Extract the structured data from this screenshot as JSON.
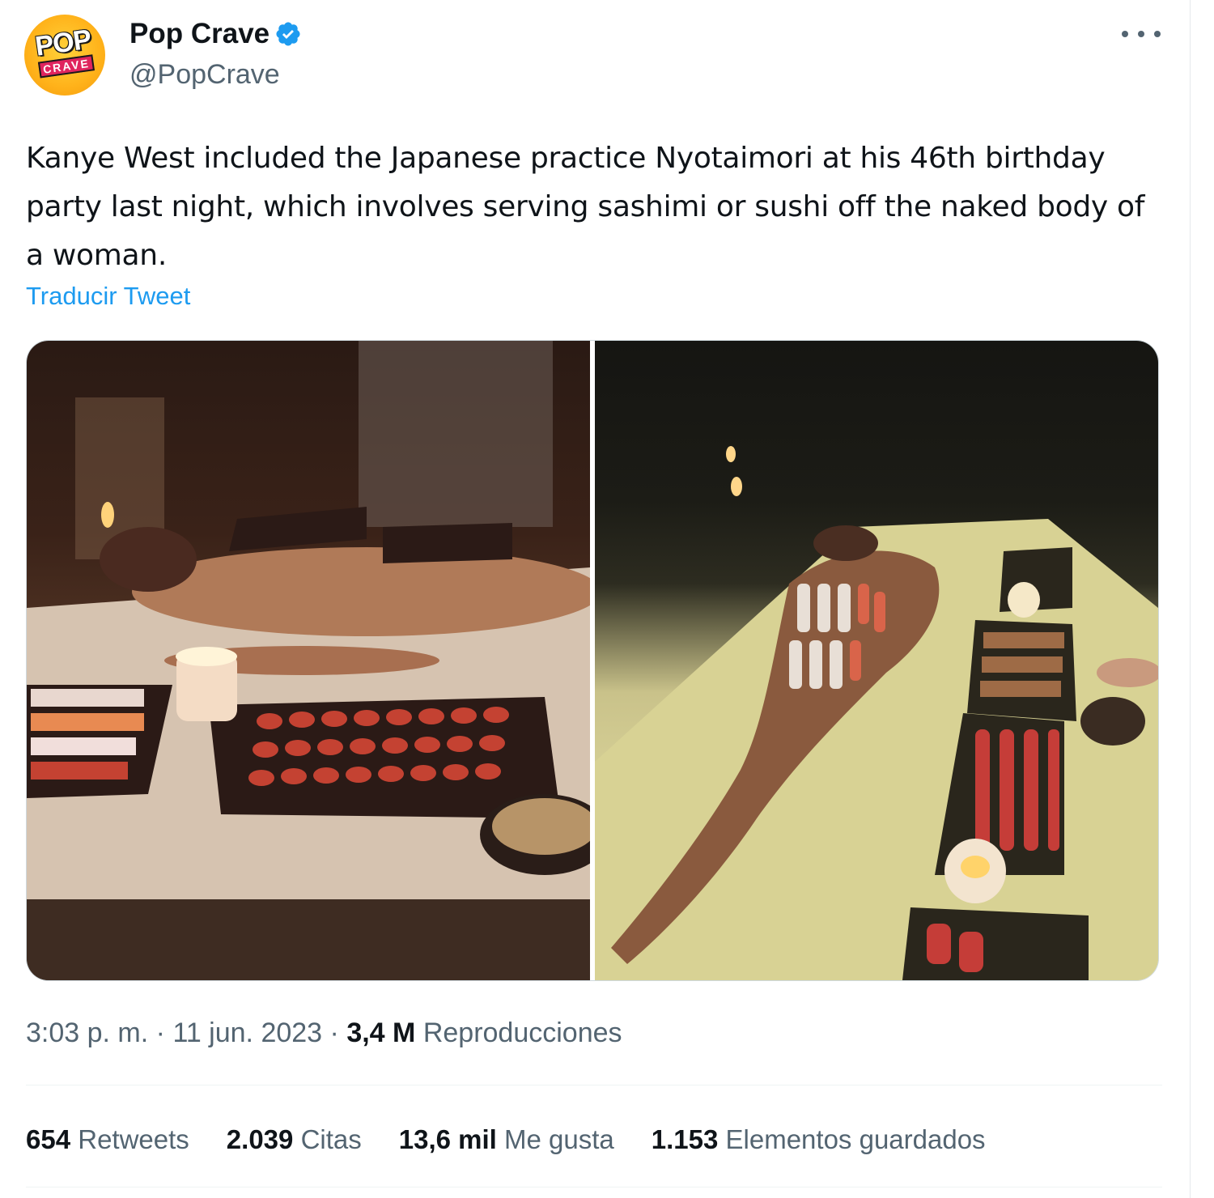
{
  "author": {
    "display_name": "Pop Crave",
    "handle": "@PopCrave",
    "avatar_text_top": "POP",
    "avatar_text_bottom": "CRAVE",
    "verified": true,
    "verified_color": "#1d9bf0"
  },
  "tweet": {
    "text": "Kanye West included the Japanese practice Nyotaimori at his 46th birthday party last night, which involves serving sashimi or sushi off the naked body of a woman.",
    "translate_label": "Traducir Tweet"
  },
  "media": {
    "count": 2,
    "photos": [
      "photo-1",
      "photo-2"
    ]
  },
  "meta": {
    "time": "3:03 p. m.",
    "separator": "·",
    "date": "11 jun. 2023",
    "views_count": "3,4 M",
    "views_label": "Reproducciones"
  },
  "stats": [
    {
      "count": "654",
      "label": "Retweets"
    },
    {
      "count": "2.039",
      "label": "Citas"
    },
    {
      "count": "13,6 mil",
      "label": "Me gusta"
    },
    {
      "count": "1.153",
      "label": "Elementos guardados"
    }
  ],
  "colors": {
    "accent": "#1d9bf0",
    "secondary_text": "#536471",
    "primary_text": "#0f1419"
  },
  "icons": {
    "more": "more-horizontal-icon",
    "verified": "verified-badge-icon"
  }
}
